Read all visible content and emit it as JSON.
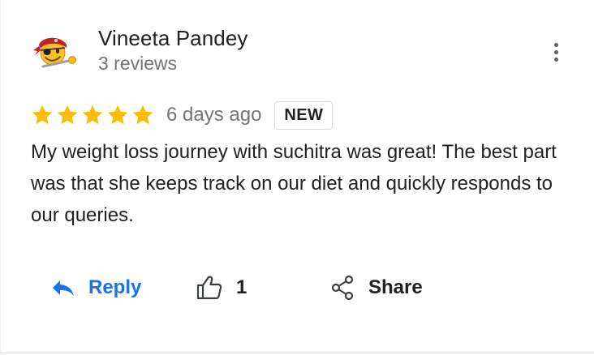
{
  "review": {
    "author": {
      "name": "Vineeta Pandey",
      "reviews_count": "3 reviews",
      "avatar_icon": "pirate-emoji-avatar-icon"
    },
    "more_menu_icon": "more-vert-icon",
    "rating": 5,
    "rating_max": 5,
    "star_color": "#fbbc04",
    "timestamp": "6 days ago",
    "badge": "NEW",
    "text": "My weight loss journey with suchitra was great! The best part was that she keeps track on our diet and quickly responds to our queries.",
    "actions": {
      "reply": {
        "label": "Reply",
        "icon": "reply-arrow-icon",
        "color": "#1a73e8"
      },
      "like": {
        "count": "1",
        "icon": "thumbs-up-icon"
      },
      "share": {
        "label": "Share",
        "icon": "share-icon"
      }
    }
  }
}
